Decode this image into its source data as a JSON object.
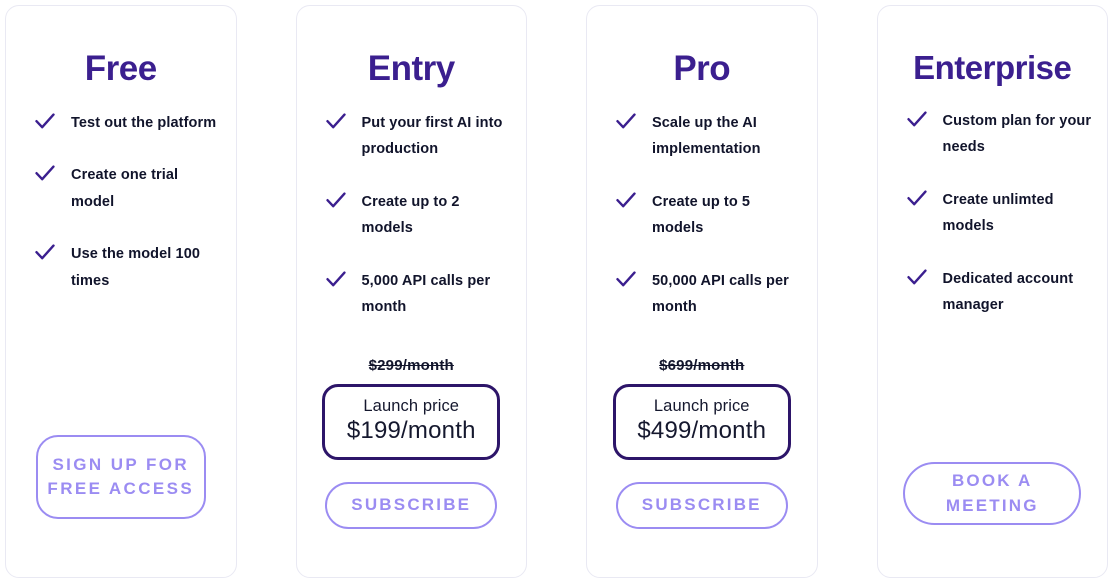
{
  "colors": {
    "heading_purple": "#3b1f8f",
    "accent_light_purple": "#9b8cf2",
    "price_box_border": "#2d1569",
    "text_dark": "#11142b",
    "card_border": "#e9e9f3",
    "card_background": "#ffffff"
  },
  "plans": [
    {
      "name": "Free",
      "features": [
        "Test out the platform",
        "Create one trial model",
        "Use the model 100 times"
      ],
      "has_pricing": false,
      "old_price": "",
      "launch_label": "",
      "launch_amount": "",
      "cta_label": "SIGN UP FOR FREE ACCESS",
      "cta_style": "three-line"
    },
    {
      "name": "Entry",
      "features": [
        "Put your first AI into production",
        "Create up to 2 models",
        "5,000 API calls per month"
      ],
      "has_pricing": true,
      "old_price": "$299/month",
      "launch_label": "Launch price",
      "launch_amount": "$199/month",
      "cta_label": "SUBSCRIBE",
      "cta_style": "one-line"
    },
    {
      "name": "Pro",
      "features": [
        "Scale up the AI implementation",
        "Create up to 5 models",
        "50,000 API calls per month"
      ],
      "has_pricing": true,
      "old_price": "$699/month",
      "launch_label": "Launch price",
      "launch_amount": "$499/month",
      "cta_label": "SUBSCRIBE",
      "cta_style": "one-line"
    },
    {
      "name": "Enterprise",
      "features": [
        "Custom plan for your needs",
        "Create unlimted models",
        "Dedicated account manager"
      ],
      "has_pricing": false,
      "old_price": "",
      "launch_label": "",
      "launch_amount": "",
      "cta_label": "BOOK A MEETING",
      "cta_style": "two-line"
    }
  ],
  "icons": {
    "check": "check-icon"
  }
}
